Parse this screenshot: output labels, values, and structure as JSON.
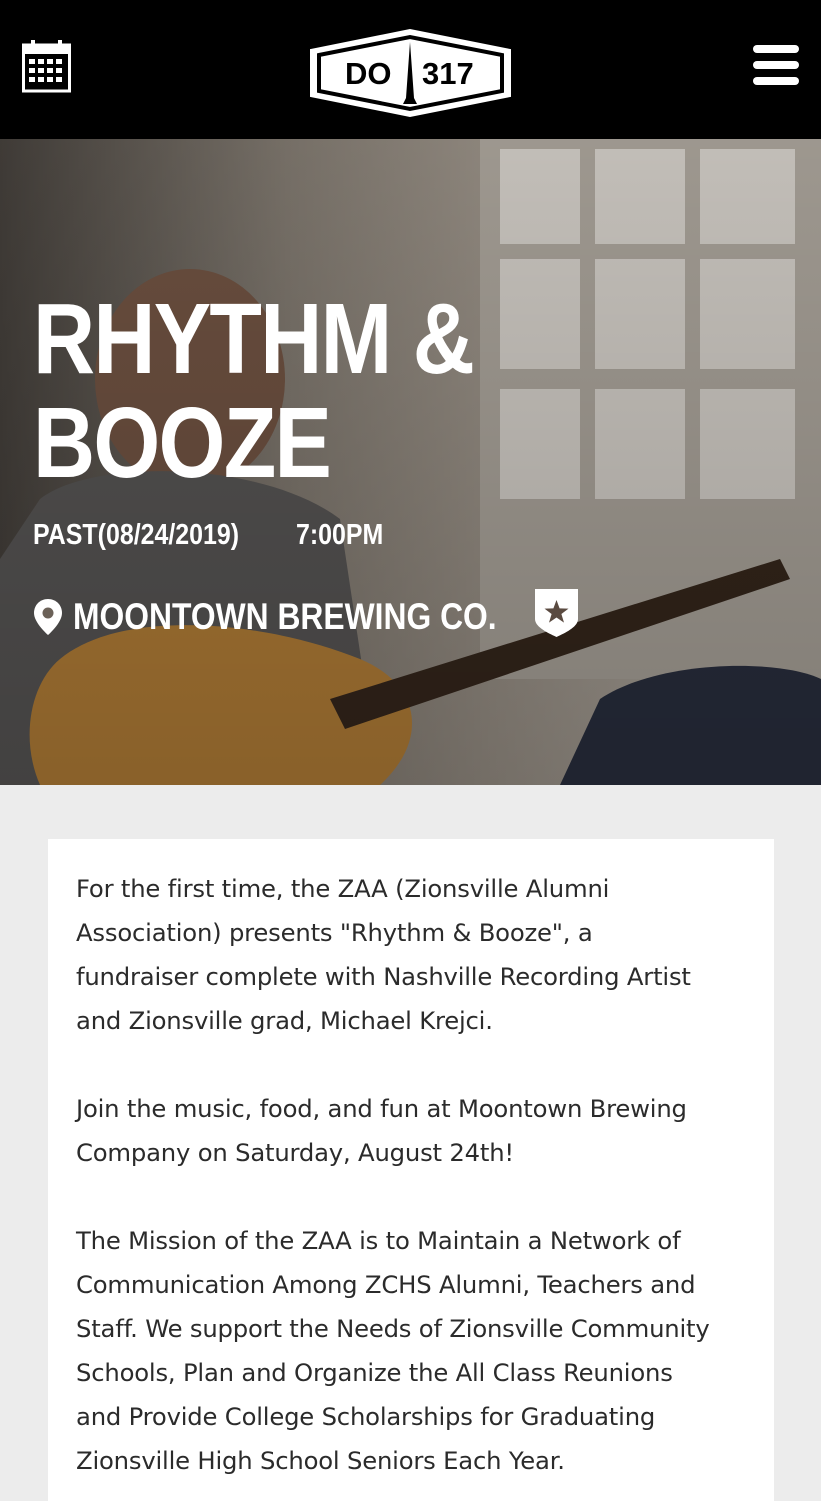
{
  "header": {
    "logo_left": "DO",
    "logo_right": "317",
    "calendar_icon": "calendar-icon",
    "menu_icon": "hamburger-menu-icon"
  },
  "event": {
    "title_line1": "RHYTHM &",
    "title_line2": "BOOZE",
    "date": "PAST(08/24/2019)",
    "time": "7:00PM",
    "venue": "MOONTOWN BREWING CO.",
    "venue_icon": "map-pin-icon",
    "badge_icon": "star-shield-icon"
  },
  "description": {
    "p1_line1": "For the first time, the ZAA (Zionsville Alumni",
    "p1_line2": "Association) presents \"Rhythm & Booze\", a",
    "p1_line3": "fundraiser complete with Nashville Recording Artist",
    "p1_line4": "and Zionsville grad, Michael Krejci.",
    "p2_line1": "Join the music, food, and fun at Moontown Brewing",
    "p2_line2": "Company on Saturday, August 24th!",
    "p3_line1": "The Mission of the ZAA is to Maintain a Network of",
    "p3_line2": "Communication Among ZCHS Alumni, Teachers and",
    "p3_line3": "Staff. We support the Needs of Zionsville Community",
    "p3_line4": "Schools, Plan and Organize the All Class Reunions",
    "p3_line5": "and Provide College Scholarships for Graduating",
    "p3_line6": "Zionsville High School Seniors Each Year."
  },
  "colors": {
    "header_bg": "#000000",
    "page_bg": "#ececec",
    "card_bg": "#ffffff",
    "body_text": "#2b2b2b"
  }
}
